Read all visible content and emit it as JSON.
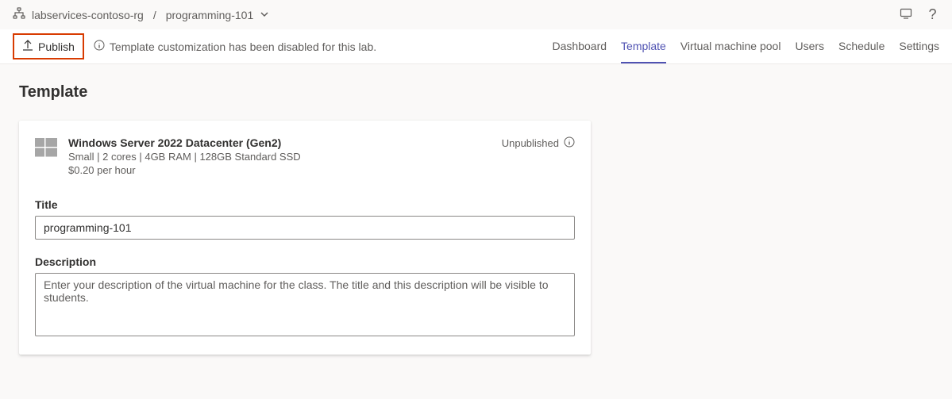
{
  "breadcrumb": {
    "resource_group": "labservices-contoso-rg",
    "lab_name": "programming-101"
  },
  "toolbar": {
    "publish_label": "Publish",
    "info_message": "Template customization has been disabled for this lab."
  },
  "tabs": {
    "dashboard": "Dashboard",
    "template": "Template",
    "vm_pool": "Virtual machine pool",
    "users": "Users",
    "schedule": "Schedule",
    "settings": "Settings"
  },
  "page": {
    "title": "Template"
  },
  "vm": {
    "os_title": "Windows Server 2022 Datacenter (Gen2)",
    "spec": "Small | 2 cores | 4GB RAM | 128GB Standard SSD",
    "price": "$0.20 per hour",
    "status": "Unpublished"
  },
  "form": {
    "title_label": "Title",
    "title_value": "programming-101",
    "description_label": "Description",
    "description_placeholder": "Enter your description of the virtual machine for the class. The title and this description will be visible to students."
  }
}
